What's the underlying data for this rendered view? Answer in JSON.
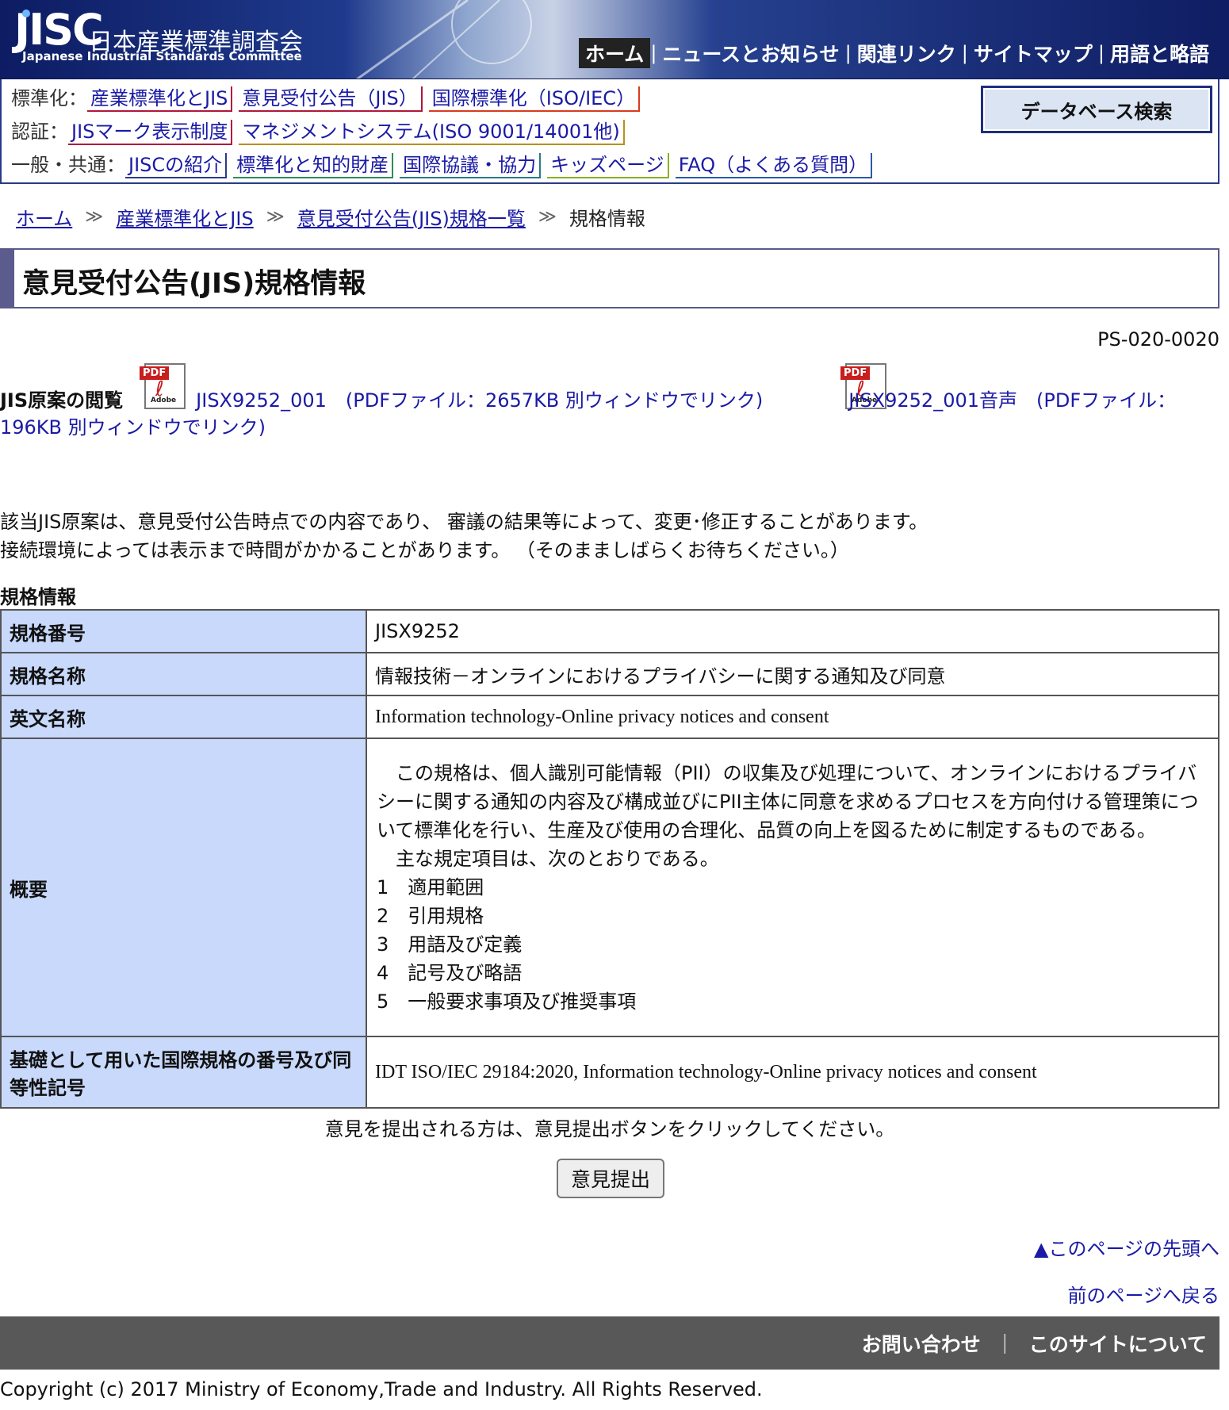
{
  "header": {
    "logo_mark": "JISC",
    "logo_jp": "日本産業標準調査会",
    "logo_en": "Japanese Industrial Standards Committee",
    "nav": [
      "ホーム",
      "ニュースとお知らせ",
      "関連リンク",
      "サイトマップ",
      "用語と略語"
    ],
    "nav_active": "ホーム",
    "colors": {
      "banner": "#0d1c63"
    }
  },
  "catnav": {
    "rows": [
      {
        "label": "標準化：",
        "links": [
          {
            "text": "産業標準化とJIS",
            "color": "#b0173c"
          },
          {
            "text": "意見受付公告（JIS）",
            "color": "#b0173c"
          },
          {
            "text": "国際標準化（ISO/IEC）",
            "color": "#d93b1e"
          }
        ]
      },
      {
        "label": "認証：",
        "links": [
          {
            "text": "JISマーク表示制度",
            "color": "#b0173c"
          },
          {
            "text": "マネジメントシステム(ISO 9001/14001他)",
            "color": "#b8901a"
          }
        ]
      },
      {
        "label": "一般・共通：",
        "links": [
          {
            "text": "JISCの紹介",
            "color": "#2a3a8a"
          },
          {
            "text": "標準化と知的財産",
            "color": "#2e8b57"
          },
          {
            "text": "国際協議・協力",
            "color": "#2a7a8a"
          },
          {
            "text": "キッズページ",
            "color": "#8ab020"
          },
          {
            "text": "FAQ（よくある質問）",
            "color": "#2a5aa8"
          }
        ]
      }
    ],
    "db_button": "データベース検索"
  },
  "breadcrumb": {
    "links": [
      "ホーム",
      "産業標準化とJIS",
      "意見受付公告(JIS)規格一覧"
    ],
    "current": "規格情報"
  },
  "page_title": "意見受付公告(JIS)規格情報",
  "ps_id": "PS-020-0020",
  "view": {
    "label": "JIS原案の閲覧",
    "pdf_label": "PDF",
    "pdf_adobe": "Adobe",
    "link1": "JISX9252_001　(PDFファイル：2657KB 別ウィンドウでリンク)　",
    "link2": "JISX9252_001音声　(PDFファイル：196KB 別ウィンドウでリンク)　"
  },
  "notice": {
    "line1": "該当JIS原案は、意見受付公告時点での内容であり、 審議の結果等によって、変更･修正することがあります。",
    "line2": "接続環境によっては表示まで時間がかかることがあります。 （そのまましばらくお待ちください。）"
  },
  "spec": {
    "heading": "規格情報",
    "rows": {
      "number": {
        "key": "規格番号",
        "value": "JISX9252"
      },
      "name": {
        "key": "規格名称",
        "value": "情報技術－オンラインにおけるプライバシーに関する通知及び同意"
      },
      "english": {
        "key": "英文名称",
        "value": "Information technology-Online privacy notices and consent"
      },
      "summary": {
        "key": "概要",
        "para1": "　この規格は、個人識別可能情報（PII）の収集及び処理について、オンラインにおけるプライバシーに関する通知の内容及び構成並びにPII主体に同意を求めるプロセスを方向付ける管理策について標準化を行い、生産及び使用の合理化、品質の向上を図るために制定するものである。",
        "para2": "　主な規定項目は、次のとおりである。",
        "items": [
          "1　適用範囲",
          "2　引用規格",
          "3　用語及び定義",
          "4　記号及び略語",
          "5　一般要求事項及び推奨事項"
        ]
      },
      "intl": {
        "key": "基礎として用いた国際規格の番号及び同等性記号",
        "value": "IDT ISO/IEC 29184:2020, Information technology-Online privacy notices and consent"
      }
    }
  },
  "submit": {
    "note": "意見を提出される方は、意見提出ボタンをクリックしてください。",
    "button": "意見提出"
  },
  "links": {
    "top": "▲このページの先頭へ",
    "back": "前のページへ戻る"
  },
  "footer": {
    "items": [
      "お問い合わせ",
      "このサイトについて"
    ],
    "sep": "｜",
    "copyright": "Copyright (c) 2017 Ministry of Economy,Trade and Industry. All Rights Reserved."
  }
}
